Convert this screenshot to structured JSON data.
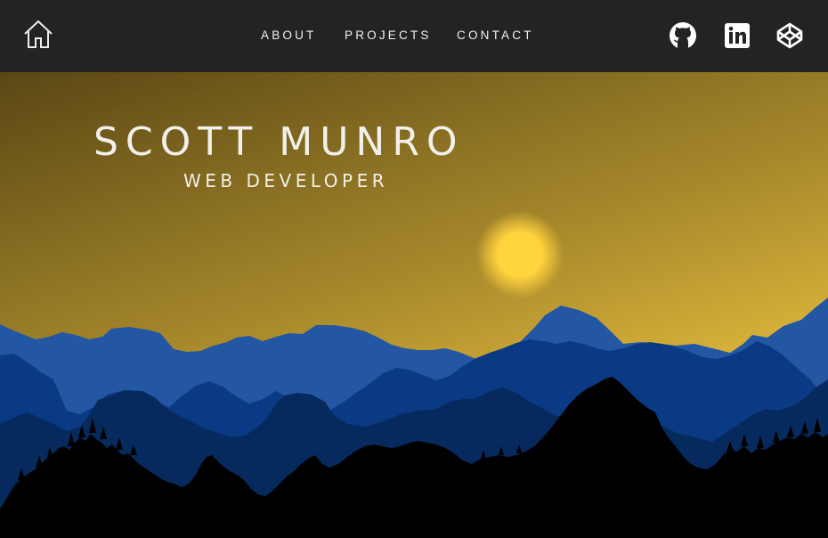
{
  "nav": {
    "home_icon": "home-icon",
    "links": [
      {
        "label": "ABOUT"
      },
      {
        "label": "PROJECTS"
      },
      {
        "label": "CONTACT"
      }
    ],
    "social": [
      {
        "icon": "github-icon"
      },
      {
        "icon": "linkedin-icon"
      },
      {
        "icon": "codepen-icon"
      }
    ]
  },
  "hero": {
    "title": "SCOTT MUNRO",
    "subtitle": "WEB DEVELOPER"
  },
  "colors": {
    "nav_bg": "#232323",
    "sky_top": "#5f4c16",
    "sky_bottom": "#e7bf3e",
    "sun": "#ffd43d",
    "mountain_light": "#2457a3",
    "mountain_mid": "#0b3a85",
    "mountain_dark": "#062a5e",
    "foreground": "#000000",
    "text": "#f1f0ea"
  }
}
